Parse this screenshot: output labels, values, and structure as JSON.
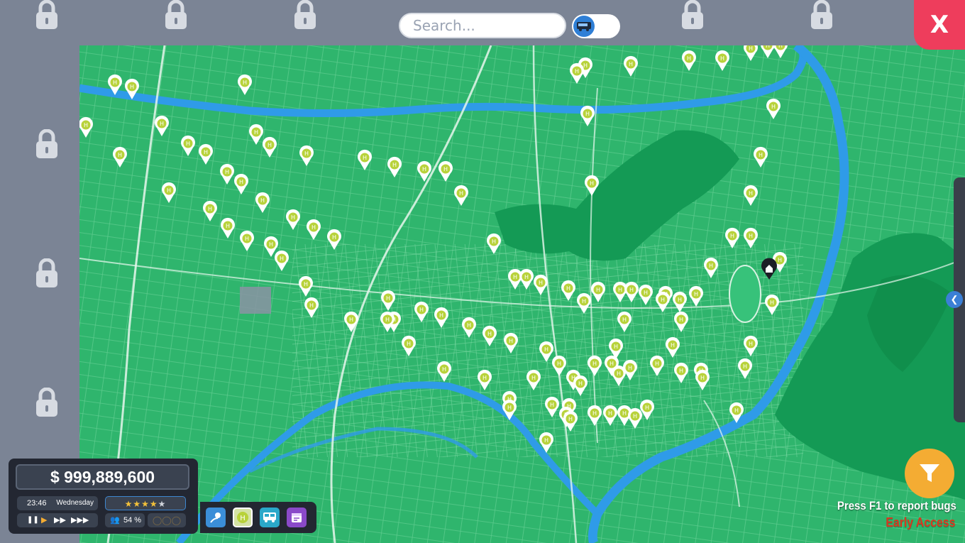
{
  "search": {
    "placeholder": "Search..."
  },
  "close_label": "X",
  "status": {
    "money": "$ 999,889,600",
    "time": "23:46",
    "day": "Wednesday",
    "rating_stars": 4.5,
    "population": "54 %"
  },
  "hud": {
    "report_text": "Press F1 to report bugs",
    "build_label": "Early Access"
  },
  "icons": {
    "lock": "lock-icon",
    "bus_toggle": "bus-icon",
    "filter": "filter-icon",
    "bus_stop": "bus-stop-icon",
    "depot": "depot-icon"
  },
  "colors": {
    "map_land": "#2fb56d",
    "river": "#2f9be8",
    "forest": "#149a55",
    "close_button": "#ee3d5c",
    "filter_button": "#f4ac33",
    "early_access": "#d8381f"
  }
}
